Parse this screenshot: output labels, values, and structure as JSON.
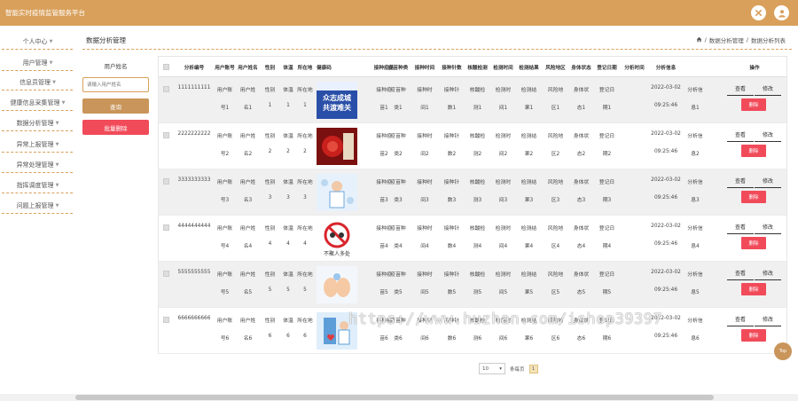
{
  "app": {
    "title": "智能实时疫情监管服务平台"
  },
  "top_icons": [
    "close-circle-icon",
    "user-icon"
  ],
  "sidebar": {
    "items": [
      {
        "label": "个人中心"
      },
      {
        "label": "用户管理"
      },
      {
        "label": "信息员管理"
      },
      {
        "label": "健康信息采集管理"
      },
      {
        "label": "数据分析管理"
      },
      {
        "label": "异常上报管理"
      },
      {
        "label": "异常处理管理"
      },
      {
        "label": "指挥调度管理"
      },
      {
        "label": "问题上报管理"
      }
    ]
  },
  "page": {
    "title": "数据分析管理",
    "breadcrumb": [
      "数据分析管理",
      "数据分析列表"
    ]
  },
  "filter": {
    "label": "用户姓名",
    "placeholder": "请输入用户姓名",
    "search_label": "查询",
    "batch_delete_label": "批量删除"
  },
  "table": {
    "headers": [
      "分析编号",
      "用户账号",
      "用户姓名",
      "性别",
      "体温",
      "所在地",
      "健康码",
      "接种疫苗",
      "疫苗种类",
      "接种时间",
      "接种针数",
      "核酸检测",
      "检测时间",
      "检测结果",
      "风险地区",
      "身体状态",
      "登记日期",
      "分析时间",
      "分析信息",
      "操作"
    ],
    "rows": [
      {
        "id": "1111111111",
        "account": [
          "用户账",
          "号1"
        ],
        "name": [
          "用户姓",
          "名1"
        ],
        "gender": [
          "性别",
          "1"
        ],
        "temp": [
          "体温",
          "1"
        ],
        "loc": [
          "所在地",
          "1"
        ],
        "thumb": "campaign-poster",
        "vacc": [
          "接种疫",
          "苗1"
        ],
        "vtype": [
          "疫苗种",
          "类1"
        ],
        "vtime": [
          "接种时",
          "间1"
        ],
        "vcount": [
          "接种针",
          "数1"
        ],
        "nucleic": [
          "核酸检",
          "测1"
        ],
        "ttime": [
          "检测时",
          "间1"
        ],
        "tresult": [
          "检测结",
          "果1"
        ],
        "risk": [
          "风险地",
          "区1"
        ],
        "body": [
          "身体状",
          "态1"
        ],
        "reg": [
          "登记日",
          "期1"
        ],
        "atime": [
          "2022-03-02",
          "09:25:46"
        ],
        "ainfo": [
          "分析信",
          "息1"
        ]
      },
      {
        "id": "2222222222",
        "account": [
          "用户账",
          "号2"
        ],
        "name": [
          "用户姓",
          "名2"
        ],
        "gender": [
          "性别",
          "2"
        ],
        "temp": [
          "体温",
          "2"
        ],
        "loc": [
          "所在地",
          "2"
        ],
        "thumb": "virus-poster",
        "vacc": [
          "接种疫",
          "苗2"
        ],
        "vtype": [
          "疫苗种",
          "类2"
        ],
        "vtime": [
          "接种时",
          "间2"
        ],
        "vcount": [
          "接种针",
          "数2"
        ],
        "nucleic": [
          "核酸检",
          "测2"
        ],
        "ttime": [
          "检测时",
          "间2"
        ],
        "tresult": [
          "检测结",
          "果2"
        ],
        "risk": [
          "风险地",
          "区2"
        ],
        "body": [
          "身体状",
          "态2"
        ],
        "reg": [
          "登记日",
          "期2"
        ],
        "atime": [
          "2022-03-02",
          "09:25:46"
        ],
        "ainfo": [
          "分析信",
          "息2"
        ]
      },
      {
        "id": "3333333333",
        "account": [
          "用户账",
          "号3"
        ],
        "name": [
          "用户姓",
          "名3"
        ],
        "gender": [
          "性别",
          "3"
        ],
        "temp": [
          "体温",
          "3"
        ],
        "loc": [
          "所在地",
          "3"
        ],
        "thumb": "doctor-illustration",
        "vacc": [
          "接种疫",
          "苗3"
        ],
        "vtype": [
          "疫苗种",
          "类3"
        ],
        "vtime": [
          "接种时",
          "间3"
        ],
        "vcount": [
          "接种针",
          "数3"
        ],
        "nucleic": [
          "核酸检",
          "测3"
        ],
        "ttime": [
          "检测时",
          "间3"
        ],
        "tresult": [
          "检测结",
          "果3"
        ],
        "risk": [
          "风险地",
          "区3"
        ],
        "body": [
          "身体状",
          "态3"
        ],
        "reg": [
          "登记日",
          "期3"
        ],
        "atime": [
          "2022-03-02",
          "09:25:46"
        ],
        "ainfo": [
          "分析信",
          "息3"
        ]
      },
      {
        "id": "4444444444",
        "account": [
          "用户账",
          "号4"
        ],
        "name": [
          "用户姓",
          "名4"
        ],
        "gender": [
          "性别",
          "4"
        ],
        "temp": [
          "体温",
          "4"
        ],
        "loc": [
          "所在地",
          "4"
        ],
        "thumb": "no-gathering-sign",
        "vacc": [
          "接种疫",
          "苗4"
        ],
        "vtype": [
          "疫苗种",
          "类4"
        ],
        "vtime": [
          "接种时",
          "间4"
        ],
        "vcount": [
          "接种针",
          "数4"
        ],
        "nucleic": [
          "核酸检",
          "测4"
        ],
        "ttime": [
          "检测时",
          "间4"
        ],
        "tresult": [
          "检测结",
          "果4"
        ],
        "risk": [
          "风险地",
          "区4"
        ],
        "body": [
          "身体状",
          "态4"
        ],
        "reg": [
          "登记日",
          "期4"
        ],
        "atime": [
          "2022-03-02",
          "09:25:46"
        ],
        "ainfo": [
          "分析信",
          "息4"
        ]
      },
      {
        "id": "5555555555",
        "account": [
          "用户账",
          "号5"
        ],
        "name": [
          "用户姓",
          "名5"
        ],
        "gender": [
          "性别",
          "5"
        ],
        "temp": [
          "体温",
          "5"
        ],
        "loc": [
          "所在地",
          "5"
        ],
        "thumb": "hands-illustration",
        "vacc": [
          "接种疫",
          "苗5"
        ],
        "vtype": [
          "疫苗种",
          "类5"
        ],
        "vtime": [
          "接种时",
          "间5"
        ],
        "vcount": [
          "接种针",
          "数5"
        ],
        "nucleic": [
          "核酸检",
          "测5"
        ],
        "ttime": [
          "检测时",
          "间5"
        ],
        "tresult": [
          "检测结",
          "果5"
        ],
        "risk": [
          "风险地",
          "区5"
        ],
        "body": [
          "身体状",
          "态5"
        ],
        "reg": [
          "登记日",
          "期5"
        ],
        "atime": [
          "2022-03-02",
          "09:25:46"
        ],
        "ainfo": [
          "分析信",
          "息5"
        ]
      },
      {
        "id": "6666666666",
        "account": [
          "用户账",
          "号6"
        ],
        "name": [
          "用户姓",
          "名6"
        ],
        "gender": [
          "性别",
          "6"
        ],
        "temp": [
          "体温",
          "6"
        ],
        "loc": [
          "所在地",
          "6"
        ],
        "thumb": "medical-illustration",
        "vacc": [
          "接种疫",
          "苗6"
        ],
        "vtype": [
          "疫苗种",
          "类6"
        ],
        "vtime": [
          "接种时",
          "间6"
        ],
        "vcount": [
          "接种针",
          "数6"
        ],
        "nucleic": [
          "核酸检",
          "测6"
        ],
        "ttime": [
          "检测时",
          "间6"
        ],
        "tresult": [
          "检测结",
          "果6"
        ],
        "risk": [
          "风险地",
          "区6"
        ],
        "body": [
          "身体状",
          "态6"
        ],
        "reg": [
          "登记日",
          "期6"
        ],
        "atime": [
          "2022-03-02",
          "09:25:46"
        ],
        "ainfo": [
          "分析信",
          "息6"
        ]
      }
    ],
    "actions": {
      "view": "查看",
      "edit": "修改",
      "delete": "删除"
    }
  },
  "pager": {
    "page_size": "10",
    "per_page_label": "条每页",
    "current_page": "1"
  },
  "top_button": "Top",
  "poster_text": {
    "line1": "众志成城",
    "line2": "共渡难关",
    "no_gathering": "不聚人多处"
  },
  "watermark": "https://www.huzhan.com/ishop39397",
  "colors": {
    "accent": "#d9a05b",
    "danger": "#f14b5a",
    "row_alt": "#f0f0f0"
  }
}
